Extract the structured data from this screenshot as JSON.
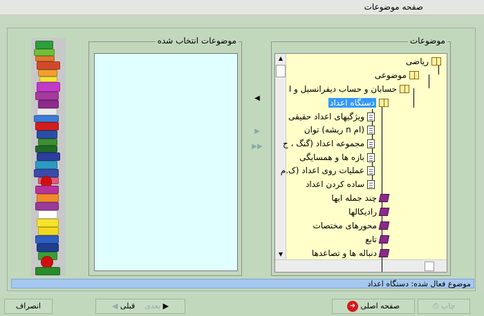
{
  "window": {
    "title": "صفحه موضوعات"
  },
  "topics_panel": {
    "caption": "موضوعات",
    "nodes": [
      {
        "label": "ریاضی",
        "icon": "book-open-icon"
      },
      {
        "label": "موضوعی",
        "icon": "book-open-icon"
      },
      {
        "label": "حسابان و حساب دیفرانسیل و ا",
        "icon": "book-open-icon"
      },
      {
        "label": "دستگاه اعداد",
        "icon": "book-open-icon",
        "selected": true
      },
      {
        "label": "ویژگیهای اعداد حقیقی",
        "icon": "document-icon"
      },
      {
        "label": "توان (ریشه n ام)",
        "icon": "document-icon"
      },
      {
        "label": "مجموعه اعداد (گنگ ، ح",
        "icon": "document-icon"
      },
      {
        "label": "بازه ها و همسایگی",
        "icon": "document-icon"
      },
      {
        "label": "عملیات روی اعداد (ک.م",
        "icon": "document-icon"
      },
      {
        "label": "ساده کردن اعداد",
        "icon": "document-icon"
      },
      {
        "label": "چند جمله ایها",
        "icon": "book-closed-icon"
      },
      {
        "label": "رادیکالها",
        "icon": "book-closed-icon"
      },
      {
        "label": "محورهای مختصات",
        "icon": "book-closed-icon"
      },
      {
        "label": "تابع",
        "icon": "book-closed-icon"
      },
      {
        "label": "دنباله ها و تصاعدها",
        "icon": "book-closed-icon"
      }
    ]
  },
  "selected_panel": {
    "caption": "موضوعات انتخاب شده"
  },
  "status": {
    "text": "موضوع فعال شده: دستگاه اعداد"
  },
  "buttons": {
    "print": "چاپ",
    "home": "صفحه اصلی",
    "next": "بعدی",
    "prev": "قبلی",
    "cancel": "انصراف"
  },
  "colors": {
    "background": "#c2d8bd",
    "tree_bg": "#ffffc9",
    "selected_list_bg": "#e0ffff",
    "status_bg": "#a6c8f0",
    "selection": "#3399ff"
  }
}
